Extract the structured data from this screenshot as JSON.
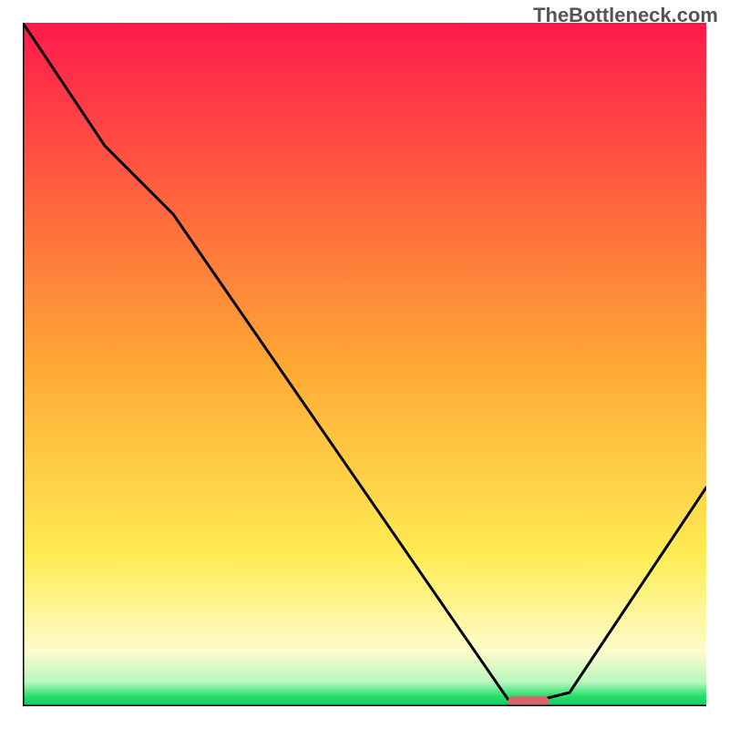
{
  "watermark": "TheBottleneck.com",
  "chart_data": {
    "type": "line",
    "title": "",
    "xlabel": "",
    "ylabel": "",
    "xlim": [
      0,
      100
    ],
    "ylim": [
      0,
      100
    ],
    "grid": false,
    "legend": false,
    "annotations": [],
    "background_gradient_stops": [
      {
        "offset": 0,
        "color": "#ff1a4b"
      },
      {
        "offset": 0.5,
        "color": "#ffa834"
      },
      {
        "offset": 0.78,
        "color": "#ffec54"
      },
      {
        "offset": 0.92,
        "color": "#fdfccb"
      },
      {
        "offset": 0.965,
        "color": "#b9f7c0"
      },
      {
        "offset": 0.985,
        "color": "#28e06a"
      },
      {
        "offset": 1.0,
        "color": "#0fc95f"
      }
    ],
    "series": [
      {
        "name": "bottleneck-curve",
        "x": [
          0,
          12,
          22,
          71,
          76,
          80,
          100
        ],
        "y_value": [
          100,
          82,
          72,
          1,
          1,
          2,
          32
        ],
        "note": "y_value is percent height of the visible curve inside the plot; 0 = bottom, 100 = top"
      }
    ],
    "marker": {
      "name": "optimal-marker",
      "x": 74,
      "y_value": 0.7,
      "width": 6,
      "color": "#d9656f"
    },
    "axes": {
      "color": "#000000",
      "width": 3
    }
  }
}
